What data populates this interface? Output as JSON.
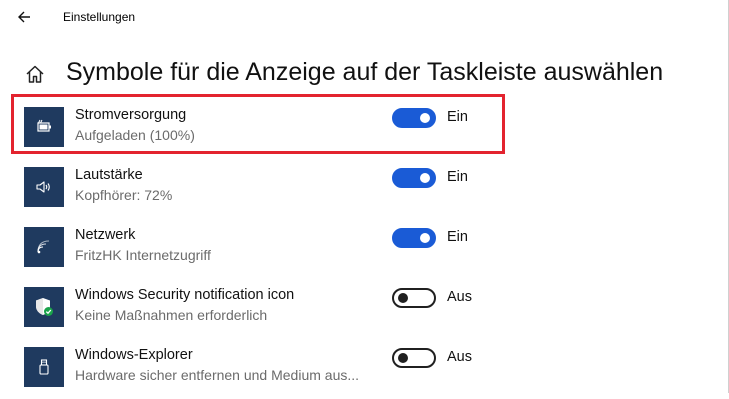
{
  "window": {
    "title": "Einstellungen"
  },
  "page": {
    "title": "Symbole für die Anzeige auf der Taskleiste auswählen"
  },
  "items": [
    {
      "icon": "battery-icon",
      "title": "Stromversorgung",
      "subtitle": "Aufgeladen (100%)",
      "state": true,
      "state_label": "Ein"
    },
    {
      "icon": "speaker-icon",
      "title": "Lautstärke",
      "subtitle": "Kopfhörer: 72%",
      "state": true,
      "state_label": "Ein"
    },
    {
      "icon": "wifi-icon",
      "title": "Netzwerk",
      "subtitle": "FritzHK Internetzugriff",
      "state": true,
      "state_label": "Ein"
    },
    {
      "icon": "security-shield-icon",
      "title": "Windows Security notification icon",
      "subtitle": "Keine Maßnahmen erforderlich",
      "state": false,
      "state_label": "Aus"
    },
    {
      "icon": "usb-drive-icon",
      "title": "Windows-Explorer",
      "subtitle": "Hardware sicher entfernen und Medium aus...",
      "state": false,
      "state_label": "Aus"
    }
  ],
  "colors": {
    "accent": "#1a5bd6",
    "tile": "#1f3a5f",
    "highlight": "#e3232f",
    "shield_check": "#1aa34a"
  }
}
